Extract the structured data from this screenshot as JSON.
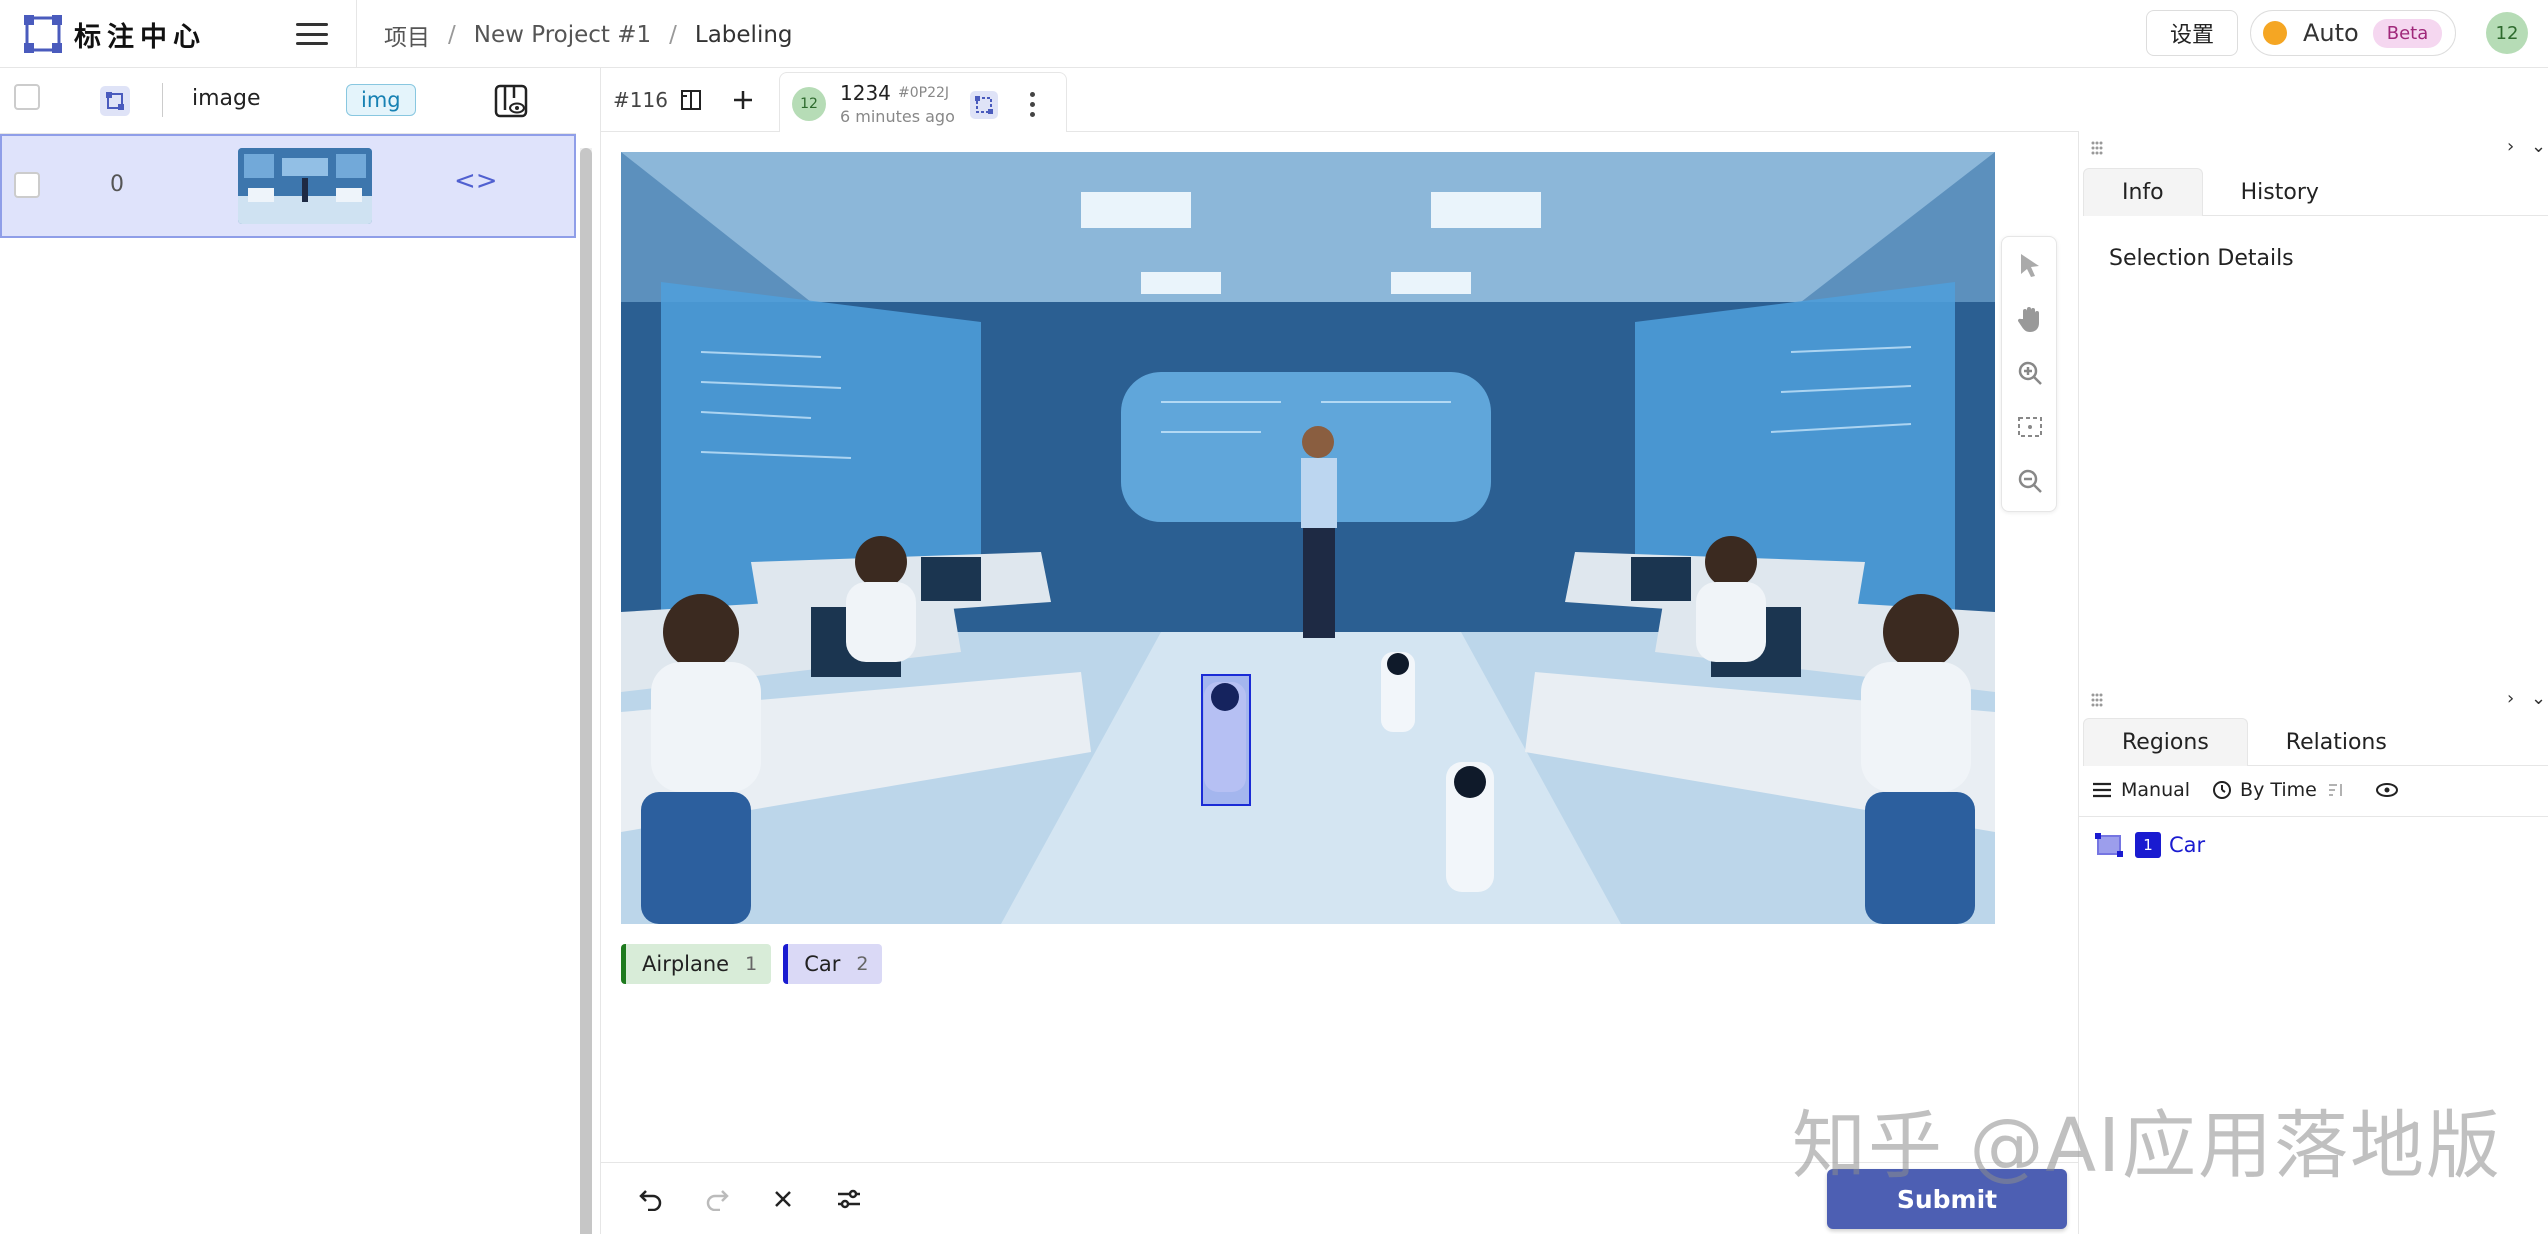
{
  "app": {
    "title": "标注中心"
  },
  "breadcrumb": {
    "items": [
      "项目",
      "New Project #1",
      "Labeling"
    ]
  },
  "header": {
    "settings_label": "设置",
    "auto_label": "Auto",
    "beta_label": "Beta",
    "user_initials": "12"
  },
  "task_list": {
    "column_image": "image",
    "column_tag": "img",
    "rows": [
      {
        "id": "0",
        "code": "<>"
      }
    ]
  },
  "task": {
    "id_label": "#116",
    "annotation": {
      "user_initials": "12",
      "name": "1234",
      "hash": "#0P22J",
      "time": "6 minutes ago"
    }
  },
  "labels": [
    {
      "name": "Airplane",
      "hotkey": "1",
      "color": "#1e7a1e"
    },
    {
      "name": "Car",
      "hotkey": "2",
      "color": "#1a1bd0"
    }
  ],
  "bottom": {
    "submit_label": "Submit"
  },
  "info_panel": {
    "tabs": [
      "Info",
      "History"
    ],
    "active": "Info",
    "title": "Selection Details"
  },
  "regions_panel": {
    "tabs": [
      "Regions",
      "Relations"
    ],
    "active": "Regions",
    "group_label": "Manual",
    "sort_label": "By Time",
    "items": [
      {
        "index": "1",
        "label": "Car",
        "color": "#1a1bd0"
      }
    ]
  },
  "watermark": "知乎 @AI应用落地版"
}
